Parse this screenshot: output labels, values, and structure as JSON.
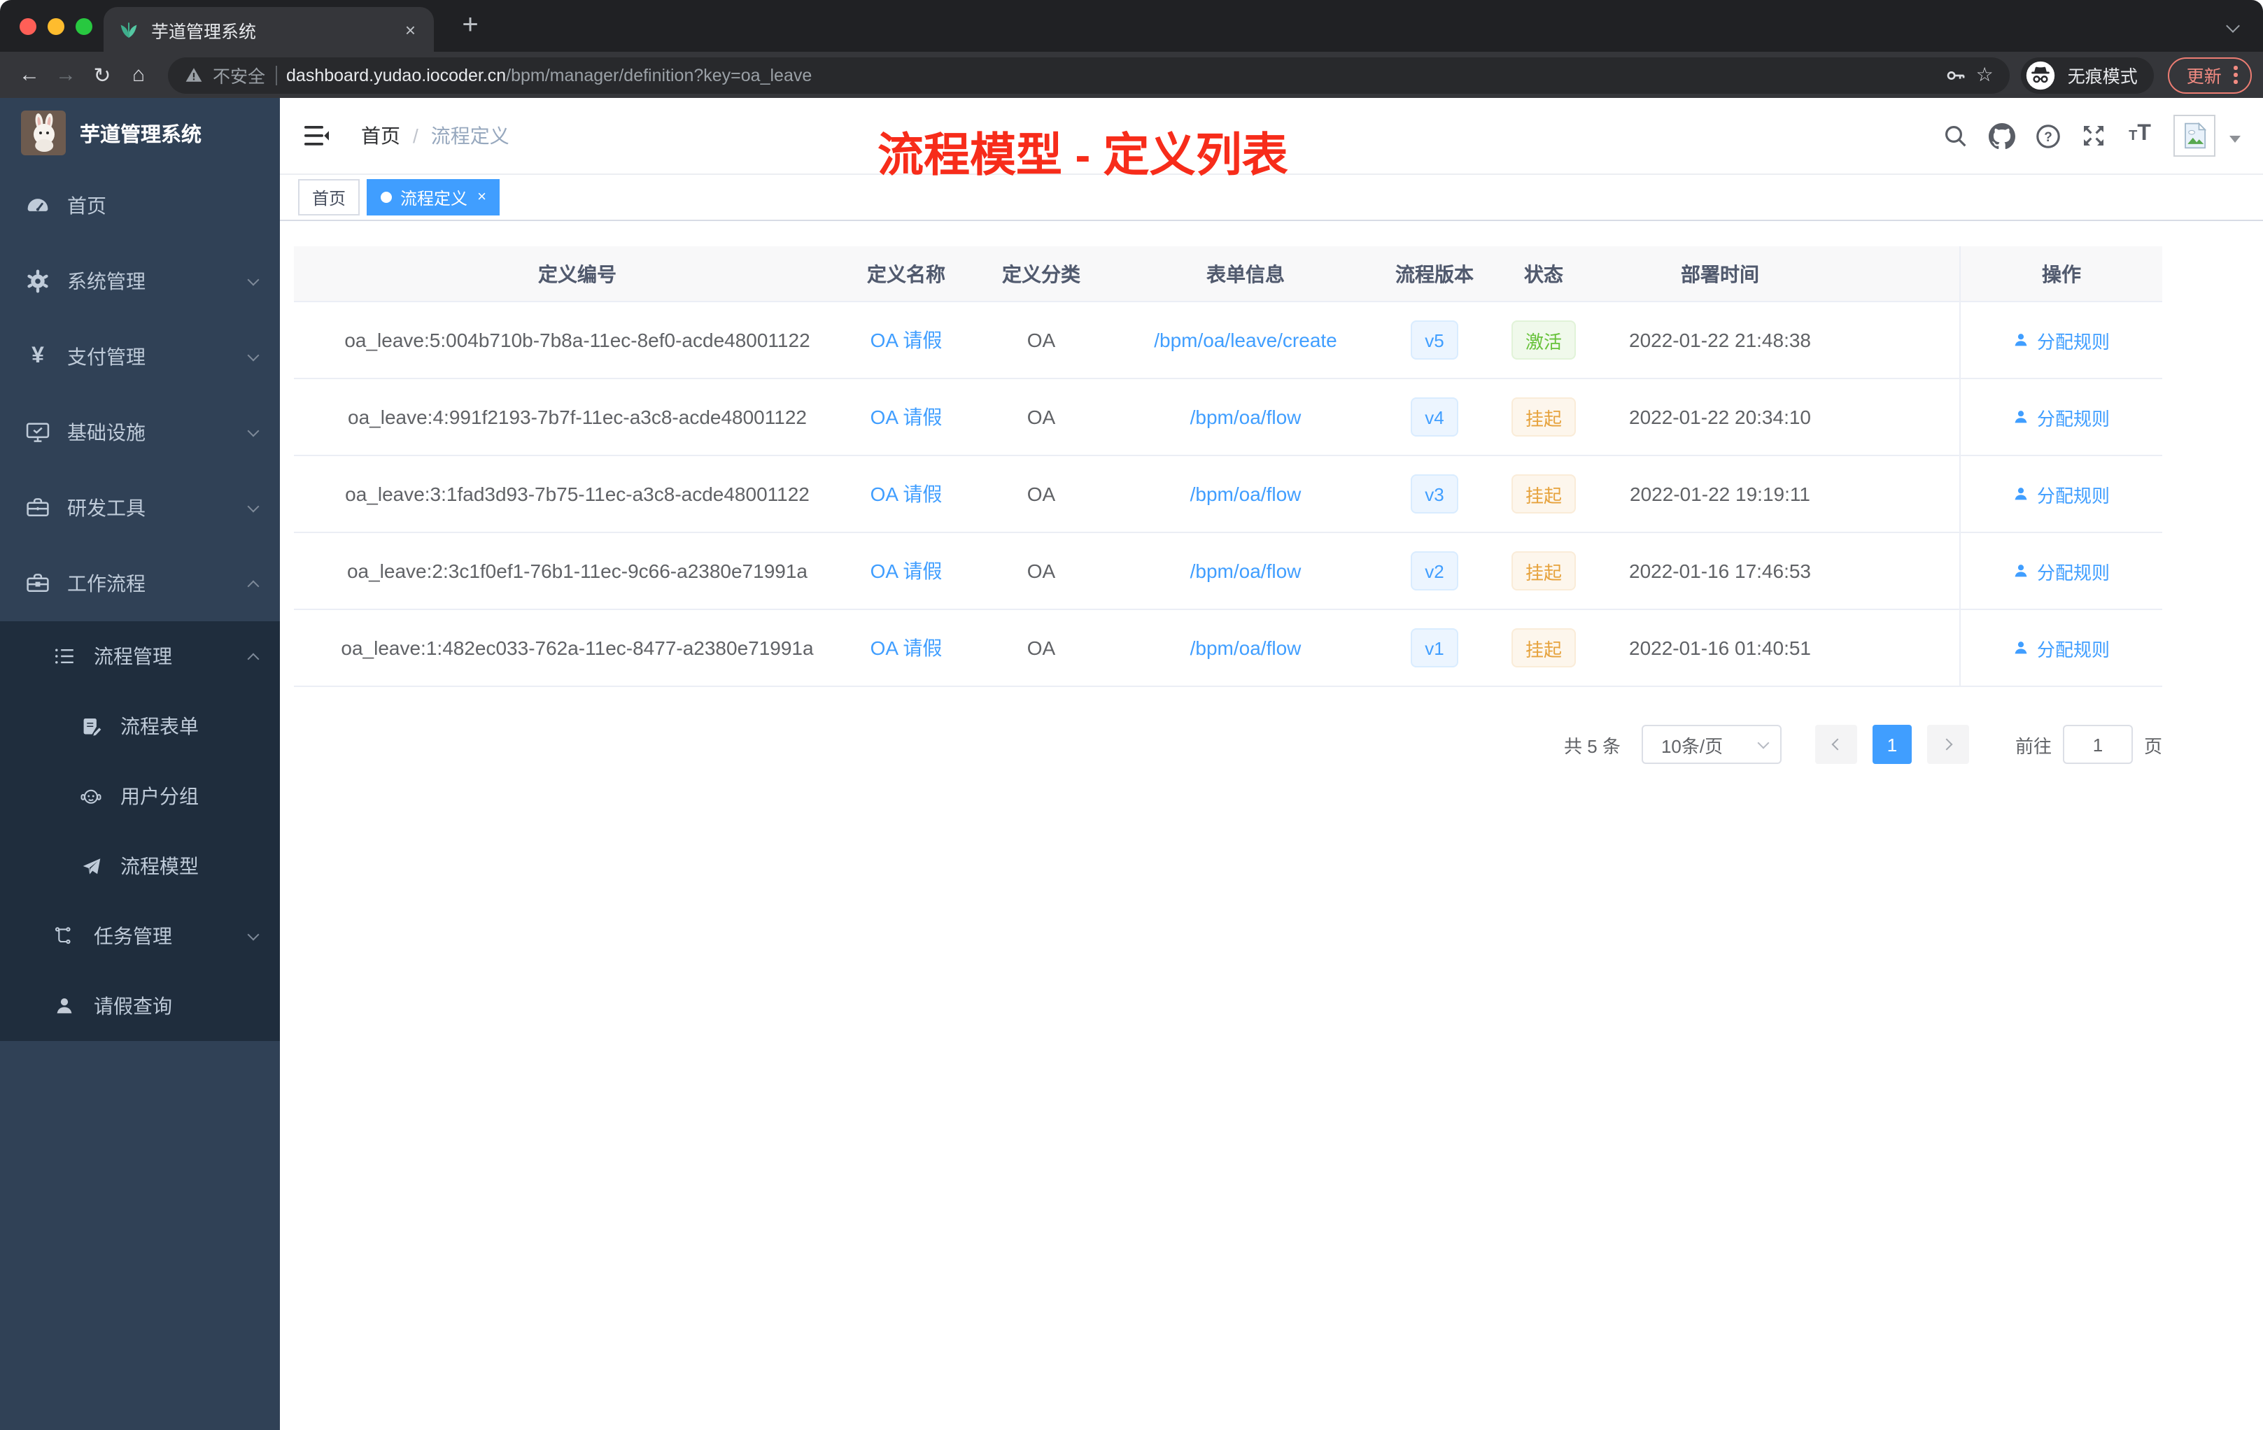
{
  "colors": {
    "accent": "#409eff",
    "success": "#67c23a",
    "warning": "#e6a23c",
    "annotation_red": "#f72c1a",
    "sidebar_bg": "#304156",
    "submenu_bg": "#1f2d3d"
  },
  "browser": {
    "tab_title": "芋道管理系统",
    "close_icon": "×",
    "new_tab_icon": "+",
    "back_icon": "←",
    "forward_icon": "→",
    "reload_icon": "↻",
    "home_icon": "⌂",
    "security_label": "不安全",
    "url_domain": "dashboard.yudao.iocoder.cn",
    "url_path": "/bpm/manager/definition?key=oa_leave",
    "star_icon": "☆",
    "incognito_label": "无痕模式",
    "update_label": "更新"
  },
  "sidebar": {
    "logo_title": "芋道管理系统",
    "menu": [
      {
        "label": "首页",
        "icon": "dashboard-icon"
      },
      {
        "label": "系统管理",
        "icon": "gear-icon",
        "chevron": "down"
      },
      {
        "label": "支付管理",
        "icon": "yen-icon",
        "chevron": "down"
      },
      {
        "label": "基础设施",
        "icon": "monitor-icon",
        "chevron": "down"
      },
      {
        "label": "研发工具",
        "icon": "toolbox-icon",
        "chevron": "down"
      },
      {
        "label": "工作流程",
        "icon": "briefcase-icon",
        "chevron": "up"
      },
      {
        "label": "流程管理",
        "icon": "list-icon",
        "chevron": "up"
      },
      {
        "label": "流程表单",
        "icon": "form-icon"
      },
      {
        "label": "用户分组",
        "icon": "group-icon"
      },
      {
        "label": "流程模型",
        "icon": "send-icon"
      },
      {
        "label": "任务管理",
        "icon": "tree-icon",
        "chevron": "down"
      },
      {
        "label": "请假查询",
        "icon": "user-icon"
      }
    ]
  },
  "header": {
    "breadcrumb": [
      "首页",
      "流程定义"
    ],
    "separator": "/"
  },
  "annotation": {
    "text": "流程模型 - 定义列表"
  },
  "tags": [
    {
      "label": "首页",
      "active": false
    },
    {
      "label": "流程定义",
      "active": true,
      "close": "×"
    }
  ],
  "table": {
    "columns": [
      "定义编号",
      "定义名称",
      "定义分类",
      "表单信息",
      "流程版本",
      "状态",
      "部署时间",
      "操作"
    ],
    "rows": [
      {
        "id": "oa_leave:5:004b710b-7b8a-11ec-8ef0-acde48001122",
        "name": "OA 请假",
        "category": "OA",
        "form": "/bpm/oa/leave/create",
        "version": "v5",
        "status": "激活",
        "status_type": "success",
        "time": "2022-01-22 21:48:38",
        "action": "分配规则"
      },
      {
        "id": "oa_leave:4:991f2193-7b7f-11ec-a3c8-acde48001122",
        "name": "OA 请假",
        "category": "OA",
        "form": "/bpm/oa/flow",
        "version": "v4",
        "status": "挂起",
        "status_type": "warning",
        "time": "2022-01-22 20:34:10",
        "action": "分配规则"
      },
      {
        "id": "oa_leave:3:1fad3d93-7b75-11ec-a3c8-acde48001122",
        "name": "OA 请假",
        "category": "OA",
        "form": "/bpm/oa/flow",
        "version": "v3",
        "status": "挂起",
        "status_type": "warning",
        "time": "2022-01-22 19:19:11",
        "action": "分配规则"
      },
      {
        "id": "oa_leave:2:3c1f0ef1-76b1-11ec-9c66-a2380e71991a",
        "name": "OA 请假",
        "category": "OA",
        "form": "/bpm/oa/flow",
        "version": "v2",
        "status": "挂起",
        "status_type": "warning",
        "time": "2022-01-16 17:46:53",
        "action": "分配规则"
      },
      {
        "id": "oa_leave:1:482ec033-762a-11ec-8477-a2380e71991a",
        "name": "OA 请假",
        "category": "OA",
        "form": "/bpm/oa/flow",
        "version": "v1",
        "status": "挂起",
        "status_type": "warning",
        "time": "2022-01-16 01:40:51",
        "action": "分配规则"
      }
    ]
  },
  "pagination": {
    "total": "共 5 条",
    "page_size": "10条/页",
    "page": "1",
    "goto": "前往",
    "unit": "页"
  }
}
